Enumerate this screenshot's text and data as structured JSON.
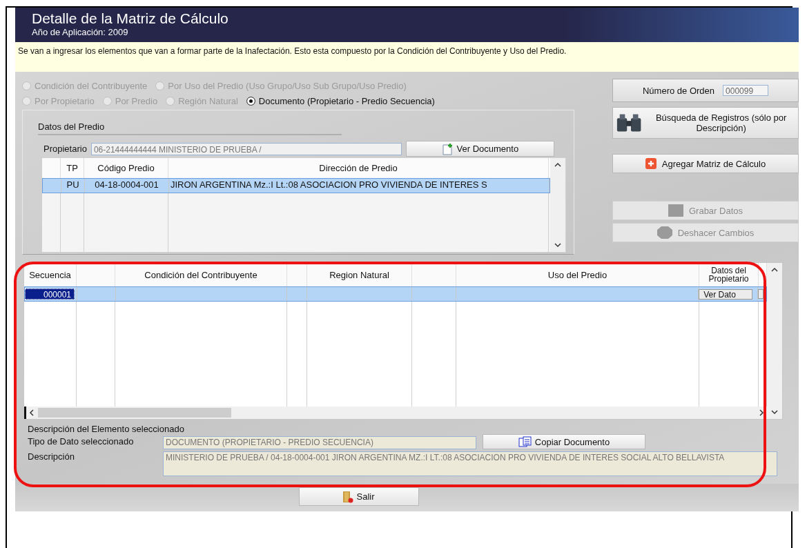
{
  "window": {
    "title": "Detalle de la Matriz de Cálculo",
    "subtitle": "Año de Aplicación: 2009"
  },
  "info_text": "Se van a ingresar los elementos que van a formar parte de la Inafectación. Esto esta compuesto por la Condición del Contribuyente y Uso del Predio.",
  "radio_rows": [
    [
      {
        "label": "Condición del Contribuyente",
        "selected": false,
        "disabled": true
      },
      {
        "label": "Por Uso del Predio (Uso Grupo/Uso Sub Grupo/Uso Predio)",
        "selected": false,
        "disabled": true
      }
    ],
    [
      {
        "label": "Por Propietario",
        "selected": false,
        "disabled": true
      },
      {
        "label": "Por Predio",
        "selected": false,
        "disabled": true
      },
      {
        "label": "Región Natural",
        "selected": false,
        "disabled": true
      },
      {
        "label": "Documento (Propietario - Predio Secuencia)",
        "selected": true,
        "disabled": false
      }
    ]
  ],
  "datos_predio": {
    "legend": "Datos del Predio",
    "propietario_label": "Propietario",
    "propietario_value": "06-21444444444 MINISTERIO DE PRUEBA  /",
    "ver_documento": "Ver Documento",
    "table": {
      "columns": [
        "TP",
        "Código Predio",
        "Dirección de Predio"
      ],
      "rows": [
        {
          "cells": [
            "PU",
            "04-18-0004-001",
            "JIRON ARGENTINA  Mz.:I Lt.:08  ASOCIACION PRO VIVIENDA DE INTERES S"
          ],
          "selected": true
        }
      ]
    }
  },
  "side": {
    "orden_label": "Número de Orden",
    "orden_value": "000099",
    "buttons": [
      {
        "kind": "search",
        "label": "Búsqueda de Registros (sólo por Descripción)",
        "disabled": false
      },
      {
        "kind": "add",
        "label": "Agregar Matriz de Cálculo",
        "disabled": false
      },
      {
        "kind": "save",
        "label": "Grabar Datos",
        "disabled": true
      },
      {
        "kind": "undo",
        "label": "Deshacer Cambios",
        "disabled": true
      }
    ]
  },
  "matrix": {
    "columns": [
      "Secuencia",
      "Condición del Contribuyente",
      "Region Natural",
      "Uso del Predio",
      "Datos del Propietario"
    ],
    "rows": [
      {
        "secuencia": "000001",
        "button": "Ver Dato",
        "selected": true
      }
    ]
  },
  "detail": {
    "heading": "Descripción del Elemento seleccionado",
    "tipo_label": "Tipo de Dato seleccionado",
    "tipo_value": "DOCUMENTO (PROPIETARIO - PREDIO SECUENCIA)",
    "copiar": "Copiar Documento",
    "descripcion_label": "Descripción",
    "descripcion_value": "MINISTERIO DE PRUEBA   / 04-18-0004-001 JIRON ARGENTINA  MZ.:I LT.:08  ASOCIACION PRO VIVIENDA DE INTERES SOCIAL ALTO BELLAVISTA"
  },
  "salir": "Salir"
}
